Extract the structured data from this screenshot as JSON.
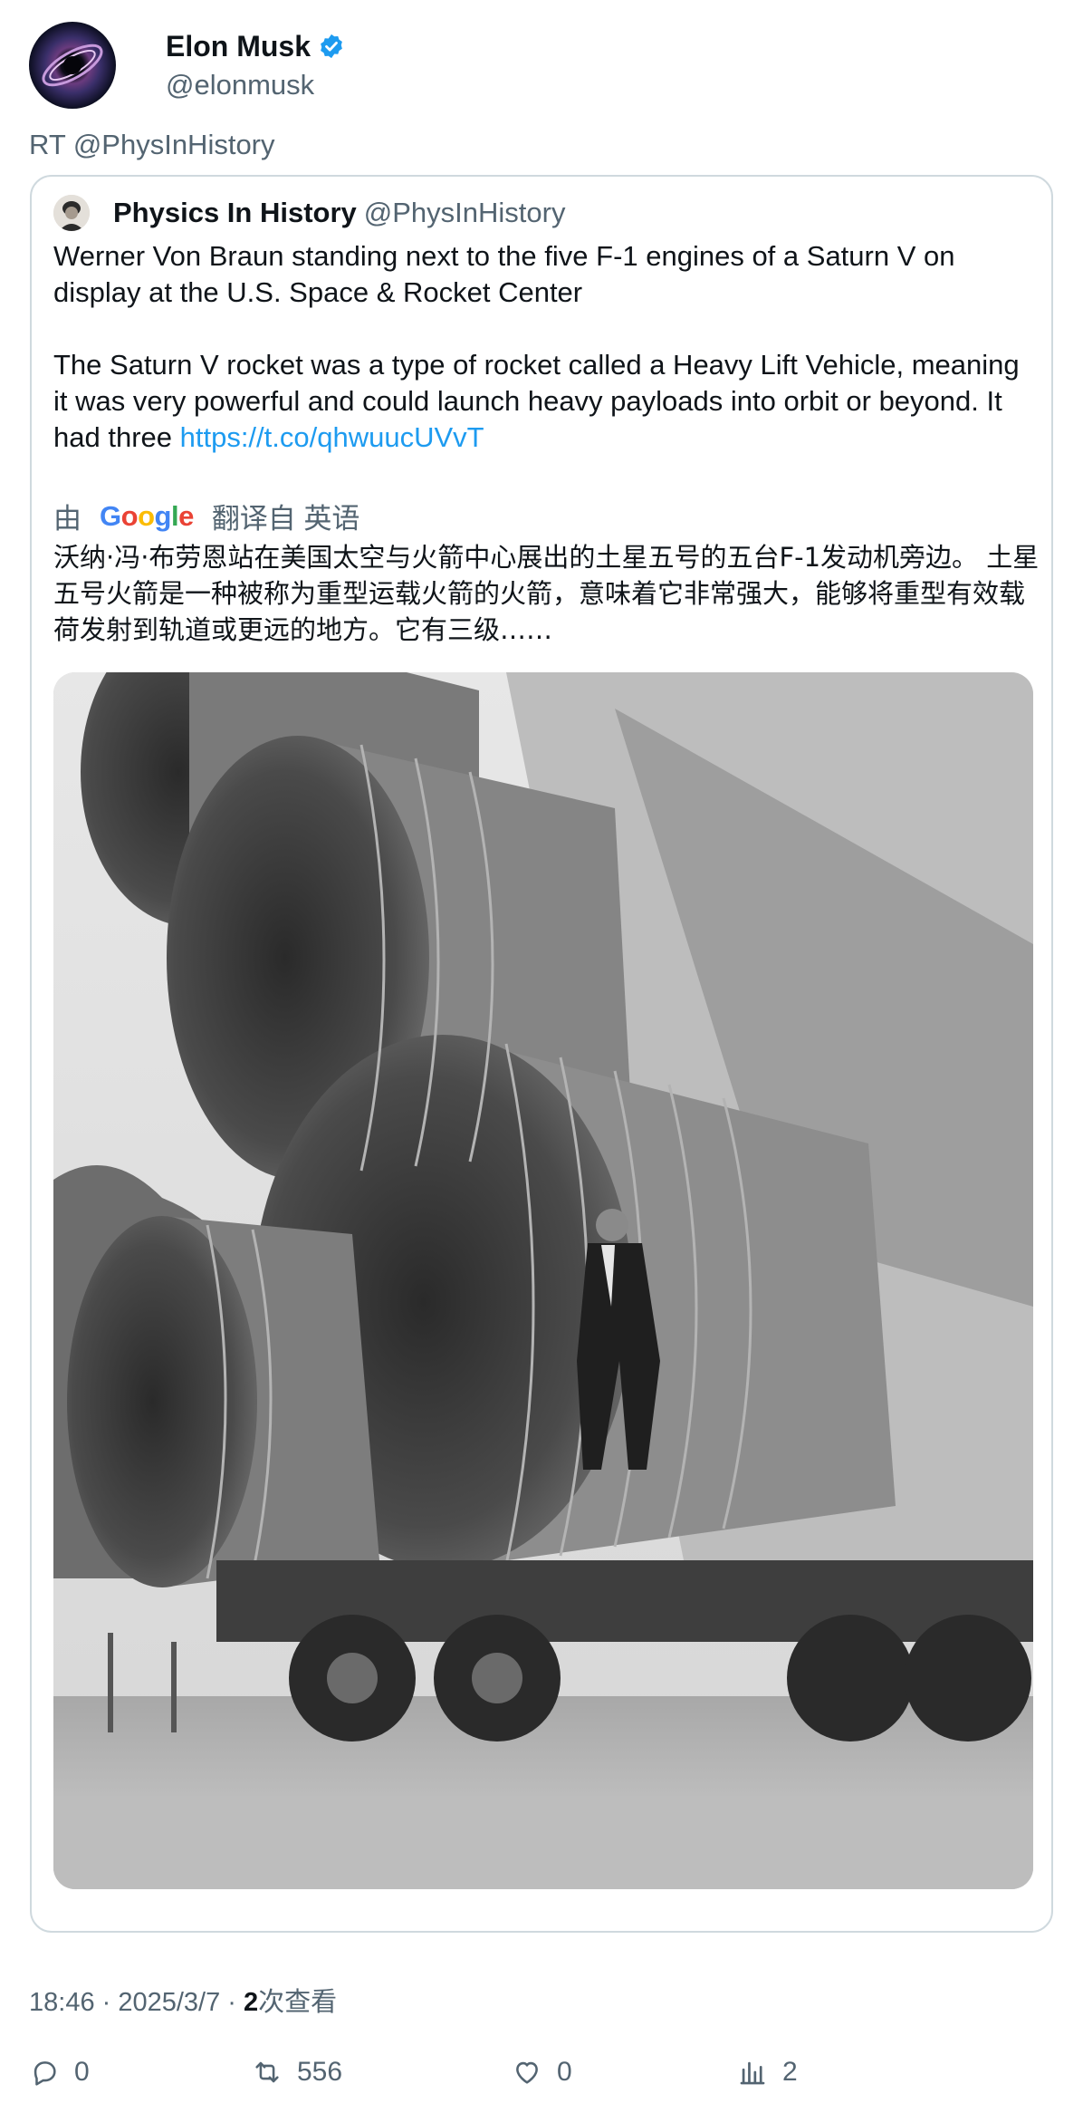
{
  "author": {
    "name": "Elon Musk",
    "handle": "@elonmusk",
    "verified_color": "#1d9bf0"
  },
  "retweet_label": "RT @PhysInHistory",
  "quoted": {
    "name": "Physics In History",
    "handle": "@PhysInHistory",
    "text_p1": "Werner Von Braun standing next to the five F-1 engines of a Saturn V on display at the U.S. Space & Rocket Center",
    "text_p2": "The Saturn V rocket was a type of rocket called a Heavy Lift Vehicle, meaning it was very powerful and could launch heavy payloads into orbit or beyond. It had three ",
    "link": "https://t.co/qhwuucUVvT",
    "translate": {
      "by": "由",
      "provider": "Google",
      "from": "翻译自 英语"
    },
    "translated_text": "沃纳·冯·布劳恩站在美国太空与火箭中心展出的土星五号的五台F-1发动机旁边。 土星五号火箭是一种被称为重型运载火箭的火箭，意味着它非常强大，能够将重型有效载荷发射到轨道或更远的地方。它有三级……"
  },
  "meta": {
    "time": "18:46 · 2025/3/7 · ",
    "views_count": "2",
    "views_label": "次查看"
  },
  "actions": {
    "replies": "0",
    "retweets": "556",
    "likes": "0",
    "views": "2"
  },
  "colors": {
    "link": "#1d9bf0",
    "secondary_text": "#536471",
    "border": "#cfd9de"
  }
}
